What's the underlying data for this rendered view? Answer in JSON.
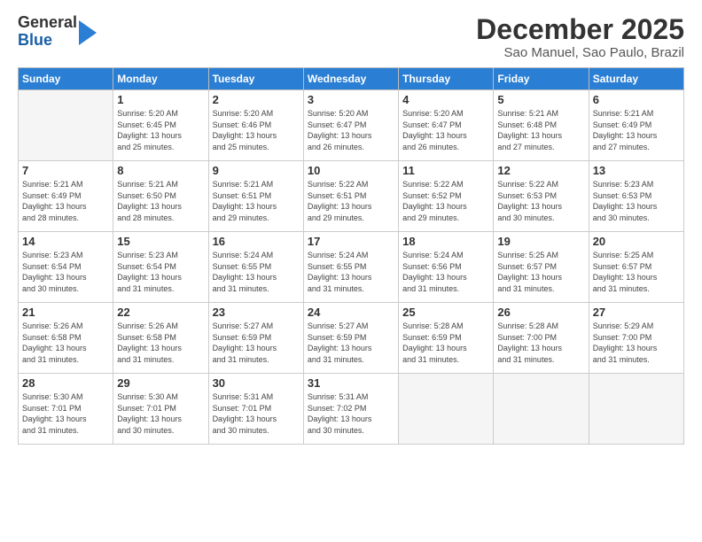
{
  "logo": {
    "line1": "General",
    "line2": "Blue"
  },
  "title": "December 2025",
  "subtitle": "Sao Manuel, Sao Paulo, Brazil",
  "header_days": [
    "Sunday",
    "Monday",
    "Tuesday",
    "Wednesday",
    "Thursday",
    "Friday",
    "Saturday"
  ],
  "weeks": [
    [
      {
        "day": "",
        "info": ""
      },
      {
        "day": "1",
        "info": "Sunrise: 5:20 AM\nSunset: 6:45 PM\nDaylight: 13 hours\nand 25 minutes."
      },
      {
        "day": "2",
        "info": "Sunrise: 5:20 AM\nSunset: 6:46 PM\nDaylight: 13 hours\nand 25 minutes."
      },
      {
        "day": "3",
        "info": "Sunrise: 5:20 AM\nSunset: 6:47 PM\nDaylight: 13 hours\nand 26 minutes."
      },
      {
        "day": "4",
        "info": "Sunrise: 5:20 AM\nSunset: 6:47 PM\nDaylight: 13 hours\nand 26 minutes."
      },
      {
        "day": "5",
        "info": "Sunrise: 5:21 AM\nSunset: 6:48 PM\nDaylight: 13 hours\nand 27 minutes."
      },
      {
        "day": "6",
        "info": "Sunrise: 5:21 AM\nSunset: 6:49 PM\nDaylight: 13 hours\nand 27 minutes."
      }
    ],
    [
      {
        "day": "7",
        "info": "Sunrise: 5:21 AM\nSunset: 6:49 PM\nDaylight: 13 hours\nand 28 minutes."
      },
      {
        "day": "8",
        "info": "Sunrise: 5:21 AM\nSunset: 6:50 PM\nDaylight: 13 hours\nand 28 minutes."
      },
      {
        "day": "9",
        "info": "Sunrise: 5:21 AM\nSunset: 6:51 PM\nDaylight: 13 hours\nand 29 minutes."
      },
      {
        "day": "10",
        "info": "Sunrise: 5:22 AM\nSunset: 6:51 PM\nDaylight: 13 hours\nand 29 minutes."
      },
      {
        "day": "11",
        "info": "Sunrise: 5:22 AM\nSunset: 6:52 PM\nDaylight: 13 hours\nand 29 minutes."
      },
      {
        "day": "12",
        "info": "Sunrise: 5:22 AM\nSunset: 6:53 PM\nDaylight: 13 hours\nand 30 minutes."
      },
      {
        "day": "13",
        "info": "Sunrise: 5:23 AM\nSunset: 6:53 PM\nDaylight: 13 hours\nand 30 minutes."
      }
    ],
    [
      {
        "day": "14",
        "info": "Sunrise: 5:23 AM\nSunset: 6:54 PM\nDaylight: 13 hours\nand 30 minutes."
      },
      {
        "day": "15",
        "info": "Sunrise: 5:23 AM\nSunset: 6:54 PM\nDaylight: 13 hours\nand 31 minutes."
      },
      {
        "day": "16",
        "info": "Sunrise: 5:24 AM\nSunset: 6:55 PM\nDaylight: 13 hours\nand 31 minutes."
      },
      {
        "day": "17",
        "info": "Sunrise: 5:24 AM\nSunset: 6:55 PM\nDaylight: 13 hours\nand 31 minutes."
      },
      {
        "day": "18",
        "info": "Sunrise: 5:24 AM\nSunset: 6:56 PM\nDaylight: 13 hours\nand 31 minutes."
      },
      {
        "day": "19",
        "info": "Sunrise: 5:25 AM\nSunset: 6:57 PM\nDaylight: 13 hours\nand 31 minutes."
      },
      {
        "day": "20",
        "info": "Sunrise: 5:25 AM\nSunset: 6:57 PM\nDaylight: 13 hours\nand 31 minutes."
      }
    ],
    [
      {
        "day": "21",
        "info": "Sunrise: 5:26 AM\nSunset: 6:58 PM\nDaylight: 13 hours\nand 31 minutes."
      },
      {
        "day": "22",
        "info": "Sunrise: 5:26 AM\nSunset: 6:58 PM\nDaylight: 13 hours\nand 31 minutes."
      },
      {
        "day": "23",
        "info": "Sunrise: 5:27 AM\nSunset: 6:59 PM\nDaylight: 13 hours\nand 31 minutes."
      },
      {
        "day": "24",
        "info": "Sunrise: 5:27 AM\nSunset: 6:59 PM\nDaylight: 13 hours\nand 31 minutes."
      },
      {
        "day": "25",
        "info": "Sunrise: 5:28 AM\nSunset: 6:59 PM\nDaylight: 13 hours\nand 31 minutes."
      },
      {
        "day": "26",
        "info": "Sunrise: 5:28 AM\nSunset: 7:00 PM\nDaylight: 13 hours\nand 31 minutes."
      },
      {
        "day": "27",
        "info": "Sunrise: 5:29 AM\nSunset: 7:00 PM\nDaylight: 13 hours\nand 31 minutes."
      }
    ],
    [
      {
        "day": "28",
        "info": "Sunrise: 5:30 AM\nSunset: 7:01 PM\nDaylight: 13 hours\nand 31 minutes."
      },
      {
        "day": "29",
        "info": "Sunrise: 5:30 AM\nSunset: 7:01 PM\nDaylight: 13 hours\nand 30 minutes."
      },
      {
        "day": "30",
        "info": "Sunrise: 5:31 AM\nSunset: 7:01 PM\nDaylight: 13 hours\nand 30 minutes."
      },
      {
        "day": "31",
        "info": "Sunrise: 5:31 AM\nSunset: 7:02 PM\nDaylight: 13 hours\nand 30 minutes."
      },
      {
        "day": "",
        "info": ""
      },
      {
        "day": "",
        "info": ""
      },
      {
        "day": "",
        "info": ""
      }
    ]
  ]
}
